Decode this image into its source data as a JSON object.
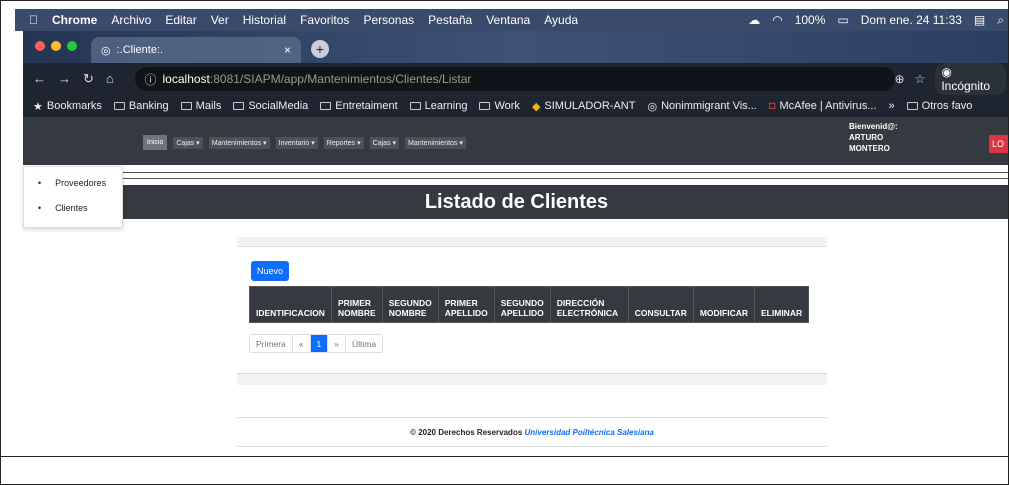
{
  "macmenu": {
    "apple": "",
    "items": [
      "Chrome",
      "Archivo",
      "Editar",
      "Ver",
      "Historial",
      "Favoritos",
      "Personas",
      "Pestaña",
      "Ventana",
      "Ayuda"
    ],
    "battery": "100%",
    "clock": "Dom ene. 24  11:33"
  },
  "tab": {
    "title": ":.Cliente:.",
    "close": "×",
    "new": "+"
  },
  "url": {
    "host": "localhost",
    "path": ":8081/SIAPM/app/Mantenimientos/Clientes/Listar",
    "incognito": "Incógnito"
  },
  "bookmarks": [
    "Bookmarks",
    "Banking",
    "Mails",
    "SocialMedia",
    "Entretaiment",
    "Learning",
    "Work",
    "SIMULADOR-ANT",
    "Nonimmigrant Vis...",
    "McAfee | Antivirus...",
    "»",
    "Otros favo"
  ],
  "app": {
    "inicio": "Inicio",
    "menu": [
      "Cajas ▾",
      "Mantenimientos ▾",
      "Inventario ▾",
      "Reportes ▾",
      "Cajas ▾",
      "Mantenimientos ▾"
    ],
    "welcome_label": "Bienvenid@:",
    "welcome_first": "ARTURO",
    "welcome_last": "MONTERO",
    "logout": "LO"
  },
  "dropdown": {
    "items": [
      "Proveedores",
      "Clientes"
    ]
  },
  "page": {
    "title": "Listado de Clientes",
    "new_button": "Nuevo",
    "columns": [
      "IDENTIFICACION",
      "PRIMER NOMBRE",
      "SEGUNDO NOMBRE",
      "PRIMER APELLIDO",
      "SEGUNDO APELLIDO",
      "DIRECCIÓN ELECTRÓNICA",
      "CONSULTAR",
      "MODIFICAR",
      "ELIMINAR"
    ],
    "pager": [
      "Primera",
      "«",
      "1",
      "»",
      "Última"
    ]
  },
  "footer": {
    "text": "© 2020 Derechos Reservados",
    "link": "Universidad Poiltécnica Salesiana"
  }
}
